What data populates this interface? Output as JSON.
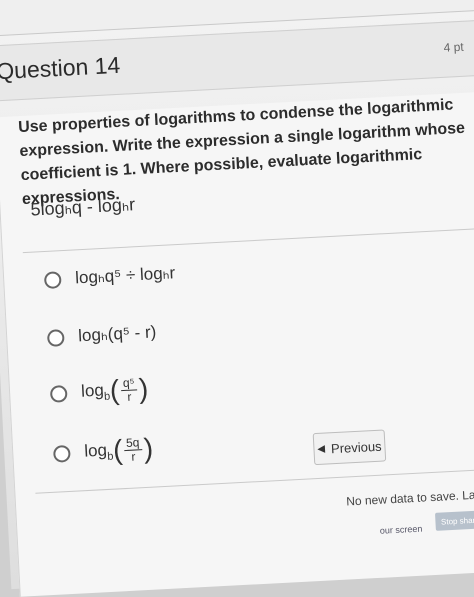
{
  "question": {
    "title": "Question 14",
    "points": "4 pt",
    "prompt": "Use properties of logarithms to condense the logarithmic expression. Write the expression a single logarithm whose coefficient is 1. Where possible, evaluate logarithmic expressions.",
    "expression": "5logₕq - logₕr"
  },
  "options": [
    {
      "text": "logₕq⁵ ÷ logₕr"
    },
    {
      "text": "logₕ(q⁵ - r)"
    },
    {
      "text": "logₕ(q⁵/r)",
      "base": "log",
      "sub": "b",
      "num": "q⁵",
      "den": "r"
    },
    {
      "text": "logₕ(5q/r)",
      "base": "log",
      "sub": "b",
      "num": "5q",
      "den": "r"
    }
  ],
  "nav": {
    "previous_label": "Previous"
  },
  "status": {
    "save_text": "No new data to save. Last checked",
    "stop_sharing": "Stop sharing",
    "your_screen": "our screen"
  }
}
